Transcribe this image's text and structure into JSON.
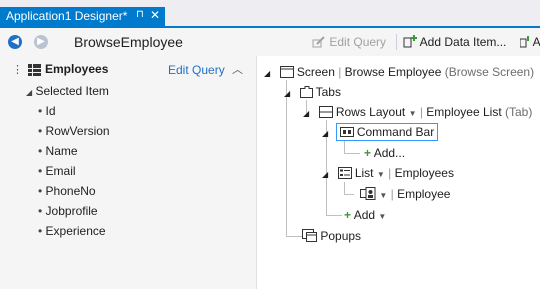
{
  "tab": {
    "title": "Application1 Designer*",
    "pin": "⊓",
    "close": "✕"
  },
  "toolbar": {
    "screen_name": "BrowseEmployee",
    "edit_query": "Edit Query",
    "add_data_item": "Add Data Item...",
    "overflow": "A"
  },
  "left_panel": {
    "title": "Employees",
    "edit_query": "Edit Query",
    "selected_item": "Selected Item",
    "fields": [
      "Id",
      "RowVersion",
      "Name",
      "Email",
      "PhoneNo",
      "Jobprofile",
      "Experience"
    ]
  },
  "tree": {
    "screen": "Screen",
    "screen_name": "Browse Employee",
    "screen_type": "(Browse Screen)",
    "tabs": "Tabs",
    "rows_layout": "Rows Layout",
    "employee_list": "Employee List",
    "tab_type": "(Tab)",
    "command_bar": "Command Bar",
    "add_ellipsis": "Add...",
    "list": "List",
    "list_source": "Employees",
    "employee": "Employee",
    "add": "Add",
    "popups": "Popups"
  }
}
